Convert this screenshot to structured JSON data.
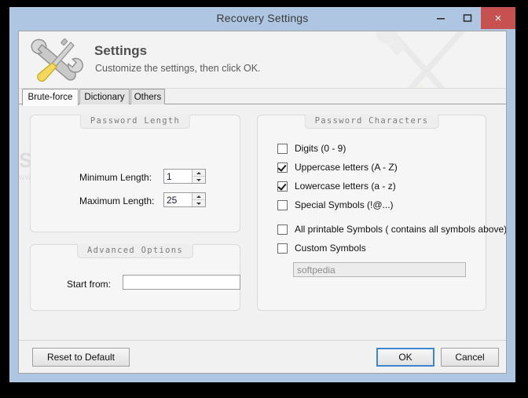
{
  "window": {
    "title": "Recovery Settings",
    "controls": {
      "minimize": "minimize",
      "maximize": "maximize",
      "close": "×"
    },
    "frame_color": "#aec6e2",
    "close_color": "#c75050"
  },
  "banner": {
    "title": "Settings",
    "subtitle": "Customize the settings, then click OK.",
    "icon": "tools-icon"
  },
  "tabs": [
    {
      "label": "Brute-force",
      "active": true
    },
    {
      "label": "Dictionary",
      "active": false
    },
    {
      "label": "Others",
      "active": false
    }
  ],
  "watermark": {
    "main": "SOFTPEDIA",
    "tm": "™",
    "sub": "www.softpedia.com"
  },
  "password_length": {
    "header": "Password Length",
    "minimum_label": "Minimum Length:",
    "minimum_value": "1",
    "maximum_label": "Maximum Length:",
    "maximum_value": "25"
  },
  "advanced_options": {
    "header": "Advanced Options",
    "start_from_label": "Start from:",
    "start_from_value": "",
    "start_from_placeholder": ""
  },
  "password_characters": {
    "header": "Password Characters",
    "checkboxes": [
      {
        "label": "Digits (0 - 9)",
        "checked": false
      },
      {
        "label": "Uppercase letters (A - Z)",
        "checked": true
      },
      {
        "label": "Lowercase letters (a - z)",
        "checked": true
      },
      {
        "label": "Special Symbols (!@...)",
        "checked": false
      },
      {
        "label": "All printable Symbols ( contains all symbols above)",
        "checked": false
      },
      {
        "label": "Custom Symbols",
        "checked": false
      }
    ],
    "custom_symbols_value": "softpedia",
    "custom_symbols_placeholder": "softpedia",
    "custom_symbols_enabled": false
  },
  "footer": {
    "reset_label": "Reset to Default",
    "ok_label": "OK",
    "cancel_label": "Cancel",
    "focus_color": "#3c87d0"
  }
}
